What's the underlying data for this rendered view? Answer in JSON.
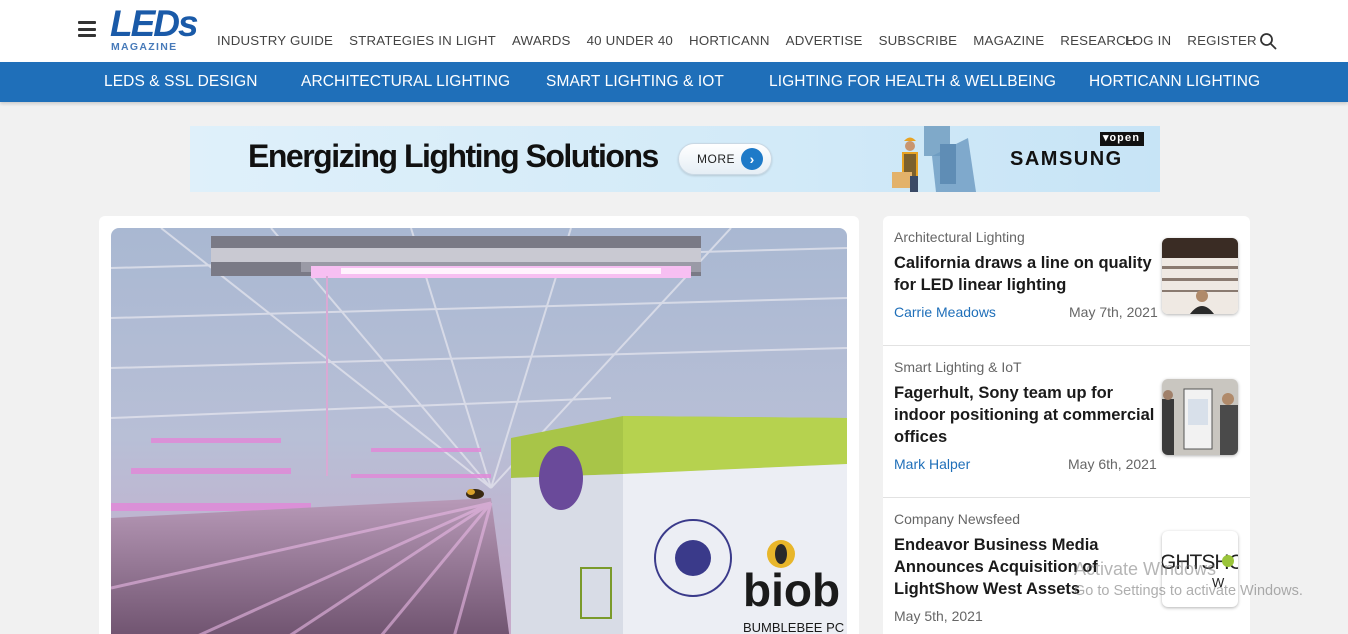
{
  "header": {
    "logo_text": "LEDs",
    "logo_subtext": "MAGAZINE",
    "nav": [
      "INDUSTRY GUIDE",
      "STRATEGIES IN LIGHT",
      "AWARDS",
      "40 UNDER 40",
      "HORTICANN",
      "ADVERTISE",
      "SUBSCRIBE",
      "MAGAZINE",
      "RESEARCH"
    ],
    "login": "LOG IN",
    "register": "REGISTER"
  },
  "category_nav": [
    "LEDS & SSL DESIGN",
    "ARCHITECTURAL LIGHTING",
    "SMART LIGHTING & IOT",
    "LIGHTING FOR HEALTH & WELLBEING",
    "HORTICANN LIGHTING"
  ],
  "ad": {
    "headline": "Energizing Lighting Solutions",
    "button": "MORE",
    "brand": "SAMSUNG",
    "tag": "open"
  },
  "articles": [
    {
      "category": "Architectural Lighting",
      "title": "California draws a line on quality for LED linear lighting",
      "author": "Carrie Meadows",
      "date": "May 7th, 2021"
    },
    {
      "category": "Smart Lighting & IoT",
      "title": "Fagerhult, Sony team up for indoor positioning at commercial offices",
      "author": "Mark Halper",
      "date": "May 6th, 2021"
    },
    {
      "category": "Company Newsfeed",
      "title": "Endeavor Business Media Announces Acquisition of LightShow West Assets",
      "author": "",
      "date": "May 5th, 2021",
      "thumb_text": "GHTSHO",
      "thumb_subtext": "W"
    }
  ],
  "hero": {
    "box_brand": "biob",
    "box_subtext": "BUMBLEBEE PC"
  },
  "watermark": {
    "line1": "Activate Windows",
    "line2": "Go to Settings to activate Windows."
  },
  "colors": {
    "brand_blue": "#1f6fb9",
    "logo_blue": "#1a5aa8"
  }
}
